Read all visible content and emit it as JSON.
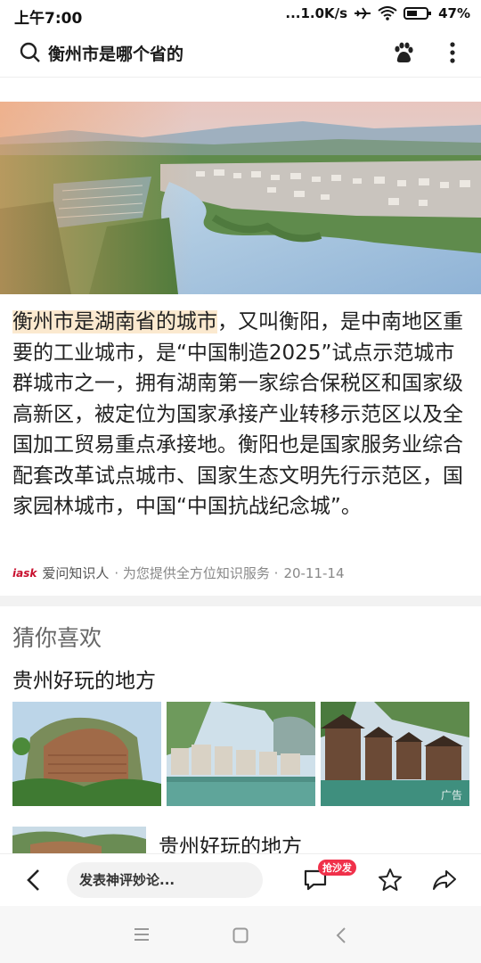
{
  "status": {
    "time": "上午7:00",
    "network_speed": "...1.0K/s",
    "battery": "47%"
  },
  "search": {
    "query": "衡州市是哪个省的"
  },
  "answer": {
    "highlight": "衡州市是湖南省的城市",
    "body": "，又叫衡阳，是中南地区重要的工业城市，是“中国制造2025”试点示范城市群城市之一，拥有湖南第一家综合保税区和国家级高新区，被定位为国家承接产业转移示范区以及全国加工贸易重点承接地。衡阳也是国家服务业综合配套改革试点城市、国家生态文明先行示范区，国家园林城市，中国“中国抗战纪念城”。"
  },
  "source": {
    "logo": "iask",
    "author": "爱问知识人",
    "description": "· 为您提供全方位知识服务 ·",
    "date": "20-11-14"
  },
  "recommend": {
    "title": "猜你喜欢",
    "card_title": "贵州好玩的地方",
    "ad_tag": "广告",
    "second_title": "贵州好玩的地方"
  },
  "bottom_bar": {
    "comment_placeholder": "发表神评妙论...",
    "hot_badge": "抢沙发"
  },
  "colors": {
    "highlight_bg": "#fbe9cf",
    "badge_red": "#f0304a",
    "divider": "#f2f2f2"
  }
}
